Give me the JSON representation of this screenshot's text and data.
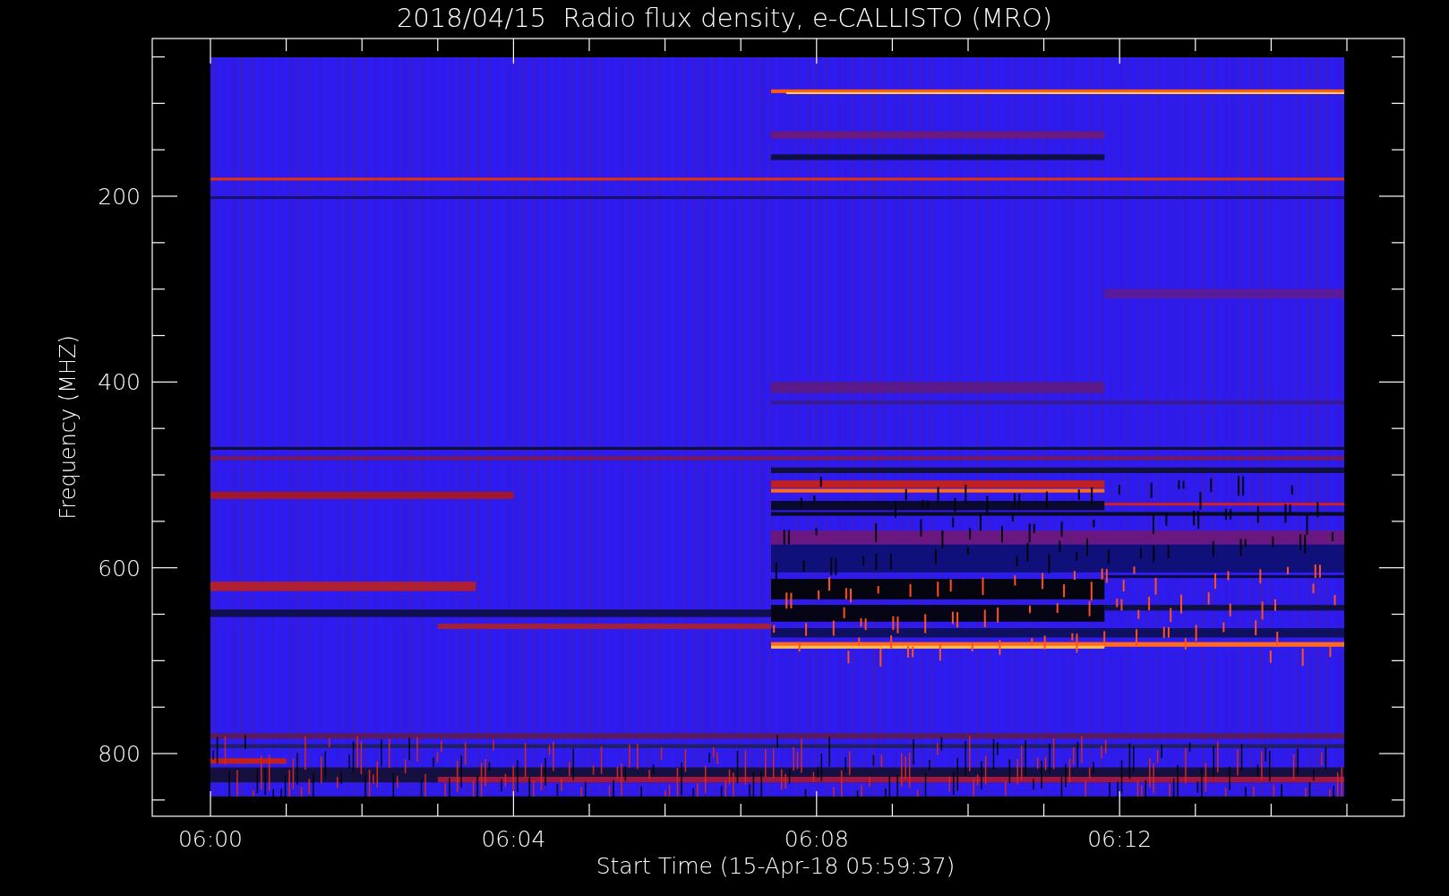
{
  "title": "2018/04/15  Radio flux density, e-CALLISTO (MRO)",
  "y_axis": {
    "label": "Frequency (MHZ)",
    "ticks": [
      "200",
      "400",
      "600",
      "800"
    ]
  },
  "x_axis": {
    "label": "Start Time (15-Apr-18 05:59:37)",
    "ticks": [
      "06:00",
      "06:04",
      "06:08",
      "06:12"
    ]
  }
}
